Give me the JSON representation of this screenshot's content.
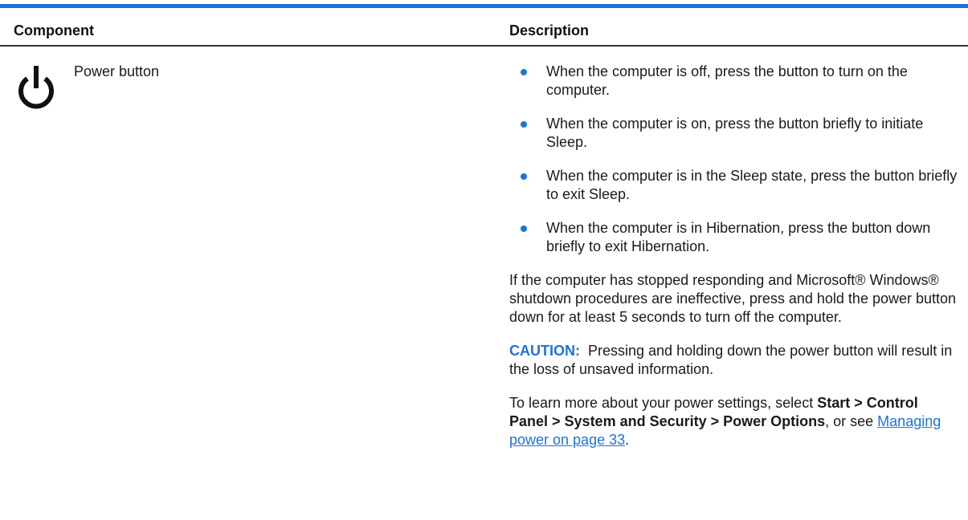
{
  "table": {
    "headers": {
      "component": "Component",
      "description": "Description"
    },
    "row": {
      "icon": "power-icon",
      "component": "Power button",
      "bullets": [
        "When the computer is off, press the button to turn on the computer.",
        "When the computer is on, press the button briefly to initiate Sleep.",
        "When the computer is in the Sleep state, press the button briefly to exit Sleep.",
        "When the computer is in Hibernation, press the button down briefly to exit Hibernation."
      ],
      "paragraph": "If the computer has stopped responding and Microsoft® Windows® shutdown procedures are ineffective, press and hold the power button down for at least 5 seconds to turn off the computer.",
      "caution": {
        "label": "CAUTION:",
        "text": "Pressing and holding down the power button will result in the loss of unsaved information."
      },
      "learn_more": {
        "prefix": "To learn more about your power settings, select ",
        "path": "Start > Control Panel > System and Security > Power Options",
        "middle": ", or see ",
        "link": "Managing power on page 33",
        "suffix": "."
      }
    }
  },
  "colors": {
    "accent": "#1d73d9",
    "text": "#1a1a1a",
    "rule": "#333333"
  }
}
